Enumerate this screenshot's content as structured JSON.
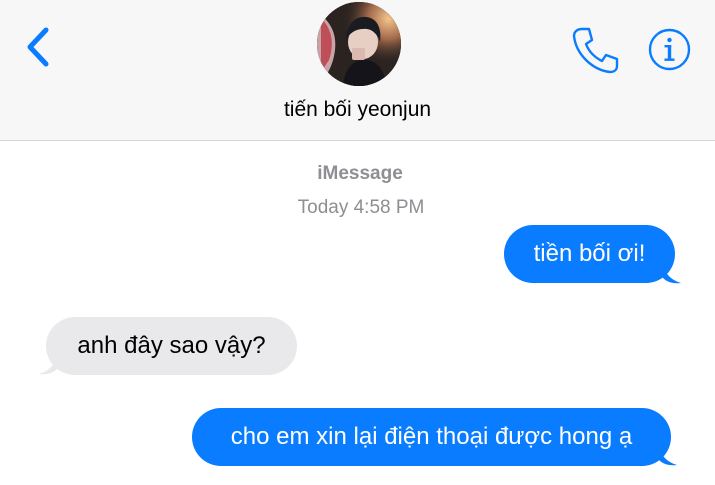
{
  "header": {
    "contact_name": "tiến bối yeonjun",
    "back_icon": "chevron-left-icon",
    "call_icon": "phone-icon",
    "info_icon": "info-icon",
    "accent_color": "#0a7cff"
  },
  "thread": {
    "service": "iMessage",
    "timestamp": "Today 4:58 PM",
    "messages": [
      {
        "direction": "outgoing",
        "text": "tiền bối ơi!"
      },
      {
        "direction": "incoming",
        "text": "anh đây sao vậy?"
      },
      {
        "direction": "outgoing",
        "text": "cho em xin lại điện thoại được hong ạ"
      }
    ]
  },
  "colors": {
    "outgoing_bubble": "#0a7cff",
    "incoming_bubble": "#e9e9eb",
    "header_background": "#f7f7f7",
    "meta_text": "#8e8e93"
  }
}
